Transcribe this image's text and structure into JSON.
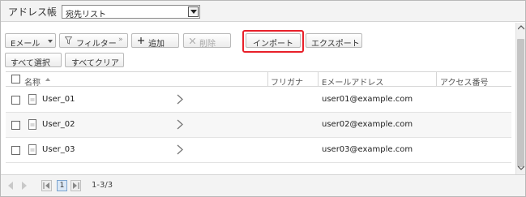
{
  "header": {
    "title": "アドレス帳",
    "address_list": "宛先リスト"
  },
  "toolbar": {
    "email_filter": "Eメール",
    "filter": "フィルター",
    "add": "追加",
    "delete": "削除",
    "import": "インポート",
    "export": "エクスポート",
    "select_all": "すべて選択",
    "clear_all": "すべてクリア"
  },
  "table": {
    "columns": {
      "name": "名称",
      "furigana": "フリガナ",
      "email": "Eメールアドレス",
      "access_number": "アクセス番号"
    },
    "rows": [
      {
        "name": "User_01",
        "furigana": "",
        "email": "user01@example.com",
        "access_number": ""
      },
      {
        "name": "User_02",
        "furigana": "",
        "email": "user02@example.com",
        "access_number": ""
      },
      {
        "name": "User_03",
        "furigana": "",
        "email": "user03@example.com",
        "access_number": ""
      }
    ]
  },
  "pager": {
    "current_page": "1",
    "range": "1-3/3"
  },
  "icons": {
    "highlight_color": "#e8202a",
    "filter": "funnel-icon",
    "add": "plus-icon",
    "delete": "x-icon",
    "entry": "document-icon",
    "row_open": "chevron-right-icon"
  }
}
